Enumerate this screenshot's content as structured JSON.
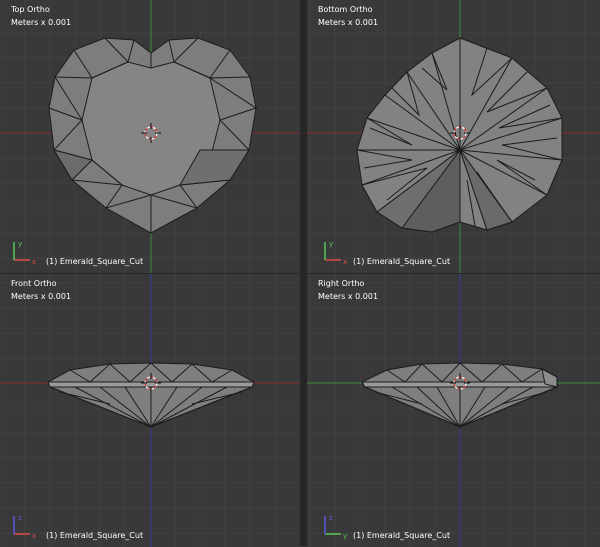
{
  "viewports": [
    {
      "id": "top",
      "title": "Top Ortho",
      "units": "Meters x 0.001",
      "object": "(1) Emerald_Square_Cut",
      "axes": [
        "x",
        "y"
      ]
    },
    {
      "id": "bottom",
      "title": "Bottom Ortho",
      "units": "Meters x 0.001",
      "object": "(1) Emerald_Square_Cut",
      "axes": [
        "x",
        "y"
      ]
    },
    {
      "id": "front",
      "title": "Front Ortho",
      "units": "Meters x 0.001",
      "object": "(1) Emerald_Square_Cut",
      "axes": [
        "x",
        "z"
      ]
    },
    {
      "id": "right",
      "title": "Right Ortho",
      "units": "Meters x 0.001",
      "object": "(1) Emerald_Square_Cut",
      "axes": [
        "y",
        "z"
      ]
    }
  ],
  "colors": {
    "background": "#393939",
    "grid_minor": "#414141",
    "grid_major": "#4a4a4a",
    "axis_x": "#8b2d2d",
    "axis_y": "#3f8a3f",
    "axis_z": "#3a3a9a",
    "gem_face": "#7d7d7d",
    "gem_edge": "#1c1c1c"
  },
  "icons": [
    "3d-cursor-icon",
    "axis-gizmo-icon"
  ]
}
